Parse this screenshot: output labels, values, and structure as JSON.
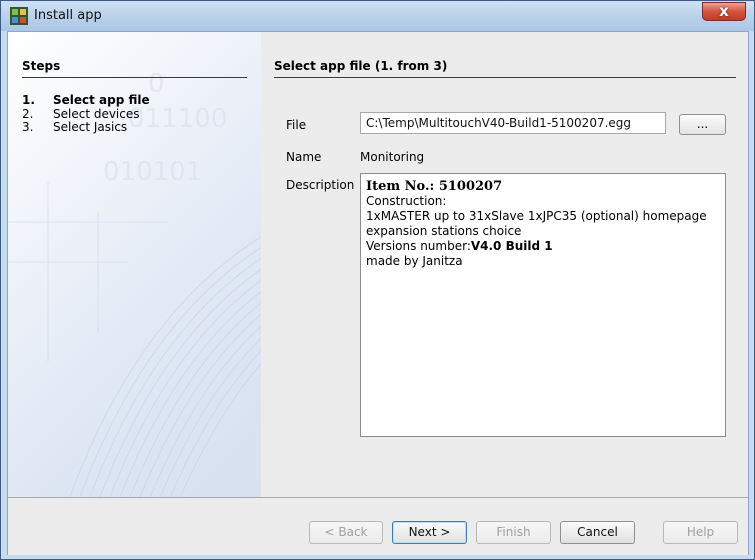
{
  "window": {
    "title": "Install app",
    "close_glyph": "x"
  },
  "sidebar": {
    "header": "Steps",
    "steps": [
      {
        "num": "1.",
        "label": "Select app file",
        "active": true
      },
      {
        "num": "2.",
        "label": "Select devices",
        "active": false
      },
      {
        "num": "3.",
        "label": "Select Jasics",
        "active": false
      }
    ]
  },
  "content": {
    "title": "Select app file (1. from 3)",
    "file_label": "File",
    "file_value": "C:\\Temp\\MultitouchV40-Build1-5100207.egg",
    "browse_label": "...",
    "name_label": "Name",
    "name_value": "Monitoring",
    "description_label": "Description",
    "description": {
      "item_label": "Item No.: 5100207",
      "construction_label": "Construction:",
      "construction_line1": "1xMASTER up to 31xSlave 1xJPC35 (optional) homepage",
      "construction_line2": "expansion stations choice",
      "version_prefix": "Versions number:",
      "version_value": "V4.0 Build 1",
      "author": "made by Janitza"
    }
  },
  "buttons": {
    "back": "< Back",
    "next": "Next >",
    "finish": "Finish",
    "cancel": "Cancel",
    "help": "Help"
  },
  "colors": {
    "title_bar": "#b7cfe9",
    "close_button": "#d5533f",
    "dialog_background": "#ececec"
  },
  "icons": {
    "app_icon": "install-app-icon",
    "close_icon": "close-icon"
  }
}
